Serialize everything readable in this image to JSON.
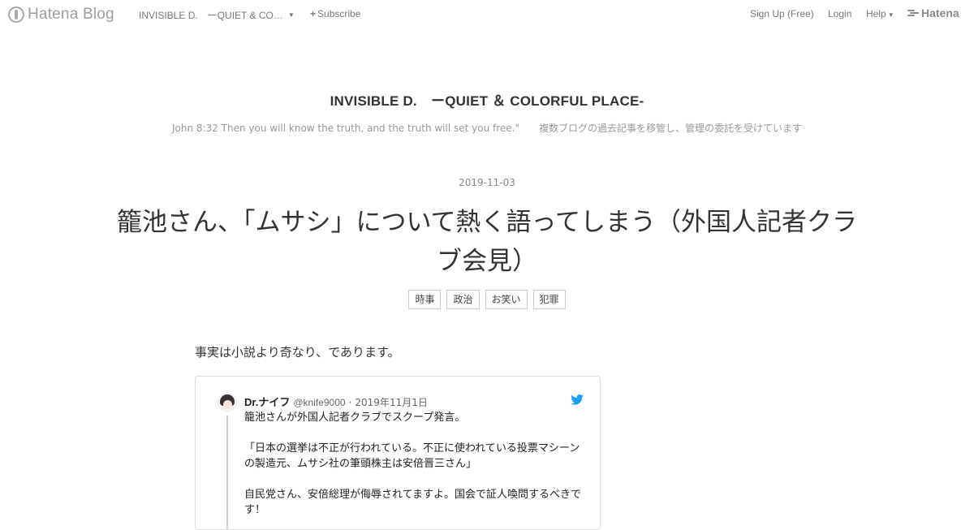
{
  "topbar": {
    "brand": "Hatena Blog",
    "blog_name_short": "INVISIBLE D.　ーQUIET & CO…",
    "subscribe_label": "Subscribe",
    "signup_label": "Sign Up (Free)",
    "login_label": "Login",
    "help_label": "Help",
    "hatena_label": "Hatena"
  },
  "blog": {
    "title": "INVISIBLE D.　ーQUIET ＆ COLORFUL PLACE-",
    "description": "John 8:32 Then you will know the truth, and the truth will set you free.\"　　複数ブログの過去記事を移管し、管理の委託を受けています"
  },
  "entry": {
    "date": "2019-11-03",
    "title": "籠池さん、「ムサシ」について熱く語ってしまう（外国人記者クラブ会見）",
    "categories": [
      "時事",
      "政治",
      "お笑い",
      "犯罪"
    ],
    "lead": "事実は小説より奇なり、であります。"
  },
  "tweet": {
    "name": "Dr.ナイフ",
    "handle": "@knife9000",
    "separator": "·",
    "date": "2019年11月1日",
    "paragraphs": [
      "籠池さんが外国人記者クラブでスクープ発言。",
      "「日本の選挙は不正が行われている。不正に使われている投票マシーンの製造元、ムサシ社の筆頭株主は安倍晋三さん」",
      "自民党さん、安倍総理が侮辱されてますよ。国会で証人喚問するべきです！"
    ]
  },
  "colors": {
    "twitter_blue": "#1da1f2",
    "text": "#333333",
    "muted": "#999999"
  }
}
